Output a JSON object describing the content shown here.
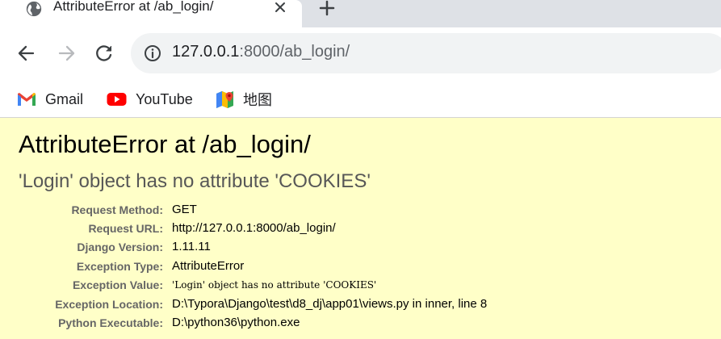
{
  "browser": {
    "tab": {
      "title": "AttributeError at /ab_login/",
      "icon": "globe-icon"
    },
    "address": {
      "host": "127.0.0.1",
      "port_and_path": ":8000/ab_login/"
    },
    "bookmarks": [
      {
        "label": "Gmail",
        "icon": "gmail-icon"
      },
      {
        "label": "YouTube",
        "icon": "youtube-icon"
      },
      {
        "label": "地图",
        "icon": "maps-icon"
      }
    ]
  },
  "error": {
    "title": "AttributeError at /ab_login/",
    "message": "'Login' object has no attribute 'COOKIES'",
    "meta": [
      {
        "key": "Request Method:",
        "value": "GET"
      },
      {
        "key": "Request URL:",
        "value": "http://127.0.0.1:8000/ab_login/"
      },
      {
        "key": "Django Version:",
        "value": "1.11.11"
      },
      {
        "key": "Exception Type:",
        "value": "AttributeError"
      },
      {
        "key": "Exception Value:",
        "value": "'Login' object has no attribute 'COOKIES'"
      },
      {
        "key": "Exception Location:",
        "value": "D:\\Typora\\Django\\test\\d8_dj\\app01\\views.py in inner, line 8"
      },
      {
        "key": "Python Executable:",
        "value": "D:\\python36\\python.exe"
      }
    ]
  },
  "colors": {
    "page_background": "#ffffc8",
    "tabstrip": "#dee1e6",
    "omnibox": "#f1f3f4",
    "youtube_red": "#ff0000"
  }
}
